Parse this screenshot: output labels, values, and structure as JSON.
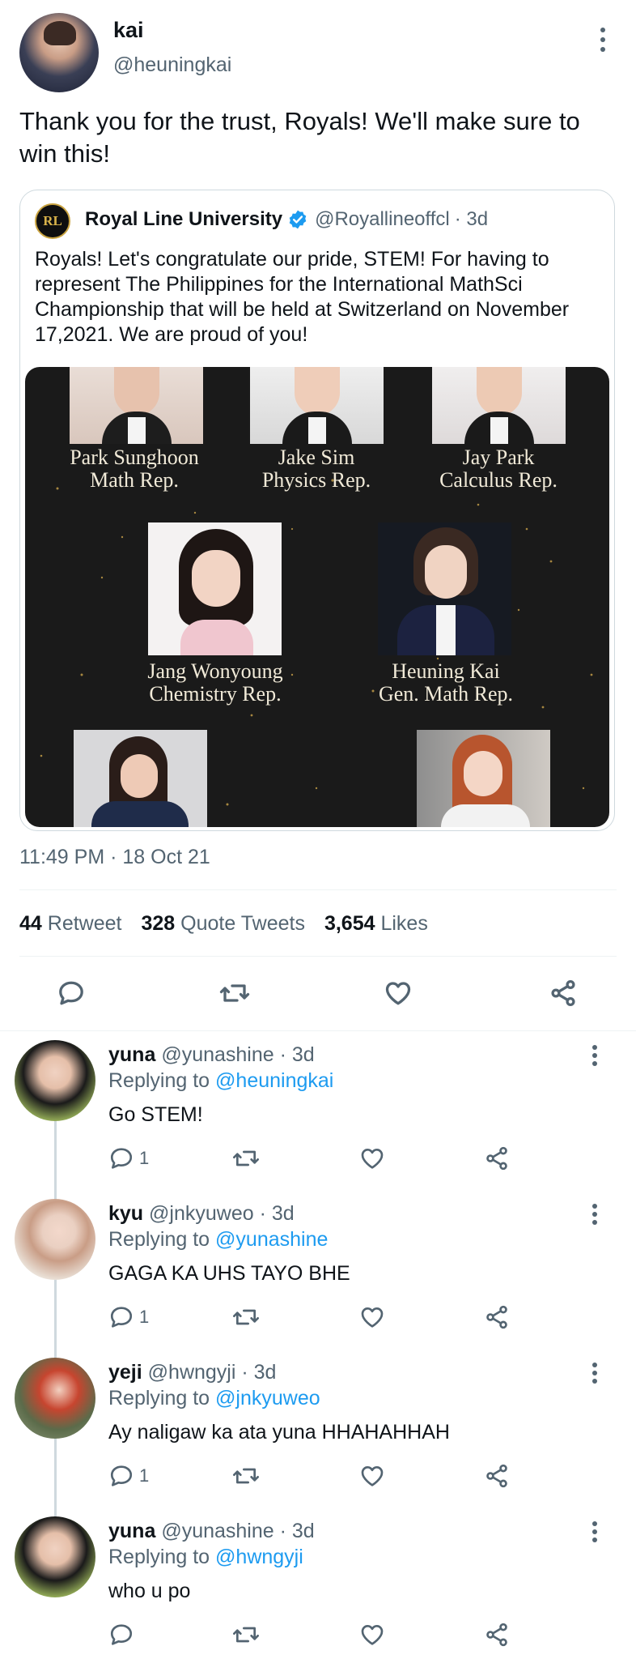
{
  "main_tweet": {
    "author_name": "kai",
    "author_handle": "@heuningkai",
    "text": "Thank you for the trust, Royals! We'll make sure to win this!",
    "timestamp": "11:49 PM · 18 Oct 21",
    "stats": {
      "retweets": "44",
      "retweets_label": "Retweet",
      "quotes": "328",
      "quotes_label": "Quote Tweets",
      "likes": "3,654",
      "likes_label": "Likes"
    }
  },
  "quoted_tweet": {
    "author_name": "Royal Line University",
    "author_handle": "@Royallineoffcl",
    "age": "· 3d",
    "logo_text": "RL",
    "text": "Royals! Let's congratulate our pride, STEM! For having to represent The Philippines for the International MathSci Championship that will be held at Switzerland on November 17,2021. We are proud of you!",
    "members": [
      {
        "name": "Park Sunghoon",
        "role": "Math Rep."
      },
      {
        "name": "Jake Sim",
        "role": "Physics Rep."
      },
      {
        "name": "Jay Park",
        "role": "Calculus Rep."
      },
      {
        "name": "Jang Wonyoung",
        "role": "Chemistry Rep."
      },
      {
        "name": "Heuning Kai",
        "role": "Gen. Math Rep."
      }
    ]
  },
  "replies": [
    {
      "name": "yuna",
      "handle": "@yunashine",
      "age": "· 3d",
      "replying_label": "Replying to",
      "replying_to": "@heuningkai",
      "text": "Go STEM!",
      "reply_count": "1"
    },
    {
      "name": "kyu",
      "handle": "@jnkyuweo",
      "age": "· 3d",
      "replying_label": "Replying to",
      "replying_to": "@yunashine",
      "text": "GAGA KA UHS TAYO BHE",
      "reply_count": "1"
    },
    {
      "name": "yeji",
      "handle": "@hwngyji",
      "age": "· 3d",
      "replying_label": "Replying to",
      "replying_to": "@jnkyuweo",
      "text": "Ay naligaw ka ata yuna HHAHAHHAH",
      "reply_count": "1"
    },
    {
      "name": "yuna",
      "handle": "@yunashine",
      "age": "· 3d",
      "replying_label": "Replying to",
      "replying_to": "@hwngyji",
      "text": "who u po",
      "reply_count": ""
    }
  ],
  "colors": {
    "accent": "#1d9bf0",
    "muted": "#536471",
    "verified": "#1d9bf0"
  },
  "icons": [
    "more-icon",
    "reply-icon",
    "retweet-icon",
    "like-icon",
    "share-icon",
    "verified-icon"
  ]
}
